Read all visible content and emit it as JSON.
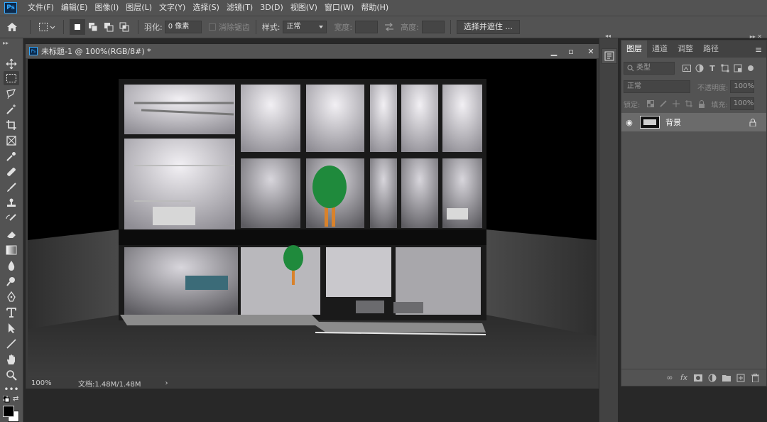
{
  "app": {
    "logo_text": "Ps"
  },
  "menu": [
    "文件(F)",
    "编辑(E)",
    "图像(I)",
    "图层(L)",
    "文字(Y)",
    "选择(S)",
    "滤镜(T)",
    "3D(D)",
    "视图(V)",
    "窗口(W)",
    "帮助(H)"
  ],
  "options": {
    "feather_label": "羽化:",
    "feather_value": "0 像素",
    "antialias_label": "消除锯齿",
    "style_label": "样式:",
    "style_value": "正常",
    "width_label": "宽度:",
    "height_label": "高度:",
    "select_mask_button": "选择并遮住 ..."
  },
  "document": {
    "title": "未标题-1 @ 100%(RGB/8#) *",
    "zoom": "100%",
    "doc_size": "文档:1.48M/1.48M"
  },
  "layers_panel": {
    "tabs": [
      "图层",
      "通道",
      "调整",
      "路径"
    ],
    "filter_placeholder": "类型",
    "blend_mode": "正常",
    "opacity_label": "不透明度:",
    "opacity_value": "100%",
    "lock_label": "锁定:",
    "fill_label": "填充:",
    "fill_value": "100%",
    "layer_name": "背景"
  },
  "colors": {
    "ui_bg": "#535353",
    "workspace": "#282828",
    "accent": "#31a8ff",
    "tree_green": "#1f8a3c",
    "trunk_orange": "#d9822b"
  }
}
